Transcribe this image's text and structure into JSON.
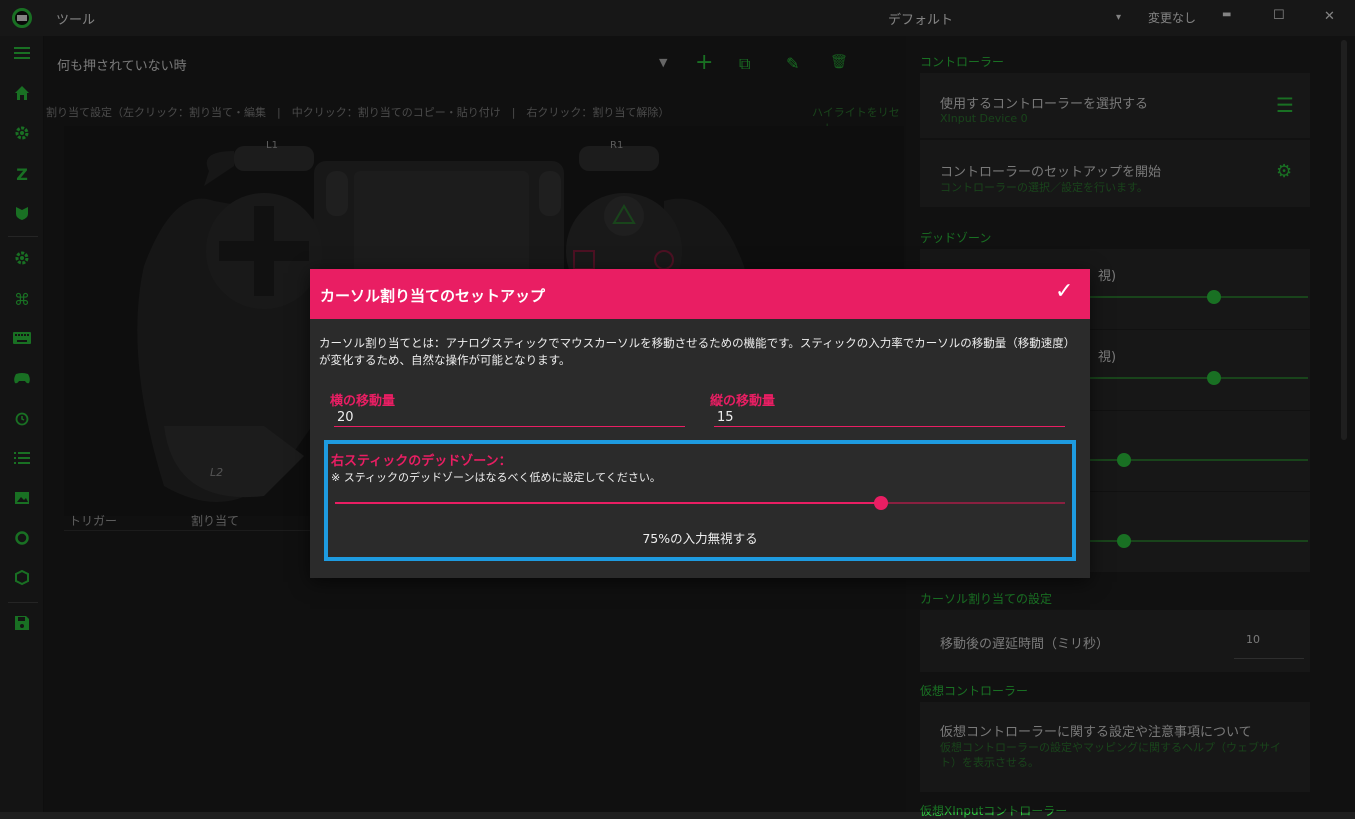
{
  "titlebar": {
    "app_title": "ツール",
    "profile": "デフォルト",
    "profile_dropdown_icon": "▾",
    "status": "変更なし",
    "minimize": "▬",
    "maximize": "☐",
    "close": "✕"
  },
  "sidebar": {
    "icons": [
      "menu-icon",
      "home-icon",
      "gear-icon",
      "sleep-z-icon",
      "shield-icon",
      "settings-icon",
      "command-icon",
      "keyboard-icon",
      "gamepad-icon",
      "alarm-icon",
      "list-icon",
      "image-icon",
      "circle-icon",
      "box-icon",
      "save-icon"
    ]
  },
  "main": {
    "state_label": "何も押されていない時",
    "toolbar": {
      "dropdown": "▼",
      "add": "+",
      "copy": "⧉",
      "edit": "✎",
      "delete": "🗑"
    },
    "hint": "割り当て設定（左クリック：割り当て・編集　|　中クリック：割り当てのコピー・貼り付け　|　右クリック：割り当て解除）",
    "reset_highlight": "ハイライトをリセット",
    "controller": {
      "l1": "L1",
      "r1": "R1",
      "l2": "L2"
    },
    "table_headers": {
      "trigger": "トリガー",
      "assign": "割り当て"
    }
  },
  "right_panel": {
    "section_controller": "コントローラー",
    "select_controller": {
      "title": "使用するコントローラーを選択する",
      "sub": "XInput Device 0",
      "icon": "☰"
    },
    "setup_controller": {
      "title": "コントローラーのセットアップを開始",
      "sub": "コントローラーの選択／設定を行います。",
      "icon": "⚙"
    },
    "section_deadzone": "デッドゾーン",
    "deadzone_rows": [
      {
        "label_partial": "視)",
        "level": 0.76
      },
      {
        "label_partial": "視)",
        "level": 0.76
      },
      {
        "label_partial": "",
        "level": 0.5
      },
      {
        "label_partial": "",
        "level": 0.5
      }
    ],
    "section_cursor": "カーソル割り当ての設定",
    "delay_label": "移動後の遅延時間（ミリ秒）",
    "delay_value": "10",
    "section_virtual": "仮想コントローラー",
    "virtual_card": {
      "title": "仮想コントローラーに関する設定や注意事項について",
      "sub": "仮想コントローラーの設定やマッピングに関するヘルプ（ウェブサイト）を表示させる。"
    },
    "section_virtual_xinput": "仮想XInputコントローラー"
  },
  "dialog": {
    "title": "カーソル割り当てのセットアップ",
    "confirm": "✓",
    "description": "カーソル割り当てとは：アナログスティックでマウスカーソルを移動させるための機能です。スティックの入力率でカーソルの移動量（移動速度）が変化するため、自然な操作が可能となります。",
    "h_label": "横の移動量",
    "h_value": "20",
    "v_label": "縦の移動量",
    "v_value": "15",
    "deadzone_label": "右スティックのデッドゾーン：",
    "deadzone_note": "※ スティックのデッドゾーンはなるべく低めに設定してください。",
    "deadzone_level": 0.75,
    "deadzone_text": "75%の入力無視する"
  },
  "colors": {
    "accent": "#e91e63",
    "green": "#2ecc40",
    "highlight": "#1e9be0"
  }
}
